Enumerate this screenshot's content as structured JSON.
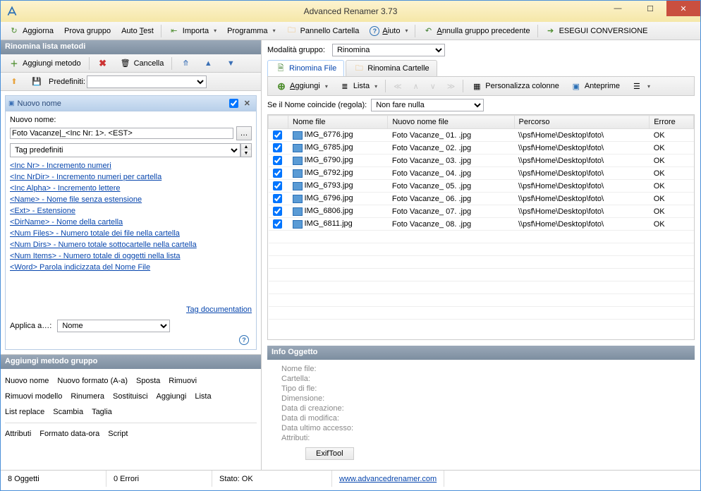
{
  "window": {
    "title": "Advanced Renamer 3.73"
  },
  "toolbar": {
    "refresh": "Aggiorna",
    "test": "Prova gruppo",
    "autotest": "Auto Test",
    "import": "Importa",
    "program": "Programma",
    "folderpanel": "Pannello Cartella",
    "help": "Aiuto",
    "undo": "Annulla gruppo precedente",
    "run": "ESEGUI CONVERSIONE"
  },
  "leftHeader": "Rinomina lista metodi",
  "leftTb": {
    "add": "Aggiungi metodo",
    "delete": "Cancella",
    "presets": "Predefiniti:"
  },
  "method": {
    "title": "Nuovo nome",
    "label": "Nuovo nome:",
    "value": "Foto Vacanze|_<Inc Nr: 1>. <EST>",
    "tagComboLabel": "Tag predefiniti",
    "tags": [
      "<Inc Nr> - Incremento numeri",
      "<Inc NrDir> - Incremento numeri per cartella",
      "<Inc Alpha> - Incremento lettere",
      "<Name> - Nome file senza estensione",
      "<Ext> - Estensione",
      "<DirName> - Nome della cartella",
      "<Num Files> - Numero totale dei file nella cartella",
      "<Num Dirs> - Numero totale sottocartelle nella cartella",
      "<Num Items> - Numero totale di oggetti nella lista",
      "<Word> Parola indicizzata del Nome File"
    ],
    "doclink": "Tag documentation",
    "applyLabel": "Applica a…:",
    "applyValue": "Nome"
  },
  "groupHeader": "Aggiungi metodo gruppo",
  "groupLinks1": [
    "Nuovo nome",
    "Nuovo formato (A-a)",
    "Sposta",
    "Rimuovi"
  ],
  "groupLinks2": [
    "Rimuovi modello",
    "Rinumera",
    "Sostituisci",
    "Aggiungi",
    "Lista"
  ],
  "groupLinks3": [
    "List replace",
    "Scambia",
    "Taglia"
  ],
  "groupLinks4": [
    "Attributi",
    "Formato data-ora",
    "Script"
  ],
  "modeLabel": "Modalità gruppo:",
  "modeValue": "Rinomina",
  "tabs": {
    "files": "Rinomina File",
    "folders": "Rinomina Cartelle"
  },
  "fileTb": {
    "add": "Aggiungi",
    "list": "Lista",
    "cols": "Personalizza colonne",
    "thumbs": "Anteprime"
  },
  "nameRule": {
    "label": "Se il Nome coincide (regola):",
    "value": "Non fare nulla"
  },
  "gridHeaders": {
    "name": "Nome file",
    "newname": "Nuovo nome file",
    "path": "Percorso",
    "error": "Errore"
  },
  "files": [
    {
      "n": "IMG_6776.jpg",
      "nn": "Foto Vacanze_ 01. .jpg",
      "p": "\\\\psf\\Home\\Desktop\\foto\\",
      "e": "OK"
    },
    {
      "n": "IMG_6785.jpg",
      "nn": "Foto Vacanze_ 02. .jpg",
      "p": "\\\\psf\\Home\\Desktop\\foto\\",
      "e": "OK"
    },
    {
      "n": "IMG_6790.jpg",
      "nn": "Foto Vacanze_ 03. .jpg",
      "p": "\\\\psf\\Home\\Desktop\\foto\\",
      "e": "OK"
    },
    {
      "n": "IMG_6792.jpg",
      "nn": "Foto Vacanze_ 04. .jpg",
      "p": "\\\\psf\\Home\\Desktop\\foto\\",
      "e": "OK"
    },
    {
      "n": "IMG_6793.jpg",
      "nn": "Foto Vacanze_ 05. .jpg",
      "p": "\\\\psf\\Home\\Desktop\\foto\\",
      "e": "OK"
    },
    {
      "n": "IMG_6796.jpg",
      "nn": "Foto Vacanze_ 06. .jpg",
      "p": "\\\\psf\\Home\\Desktop\\foto\\",
      "e": "OK"
    },
    {
      "n": "IMG_6806.jpg",
      "nn": "Foto Vacanze_ 07. .jpg",
      "p": "\\\\psf\\Home\\Desktop\\foto\\",
      "e": "OK"
    },
    {
      "n": "IMG_6811.jpg",
      "nn": "Foto Vacanze_ 08. .jpg",
      "p": "\\\\psf\\Home\\Desktop\\foto\\",
      "e": "OK"
    }
  ],
  "infoHeader": "Info Oggetto",
  "info": {
    "name": "Nome file:",
    "folder": "Cartella:",
    "type": "Tipo di fle:",
    "size": "Dimensione:",
    "created": "Data di creazione:",
    "modified": "Data di modifica:",
    "accessed": "Data ultimo accesso:",
    "attrs": "Attributi:",
    "exif": "ExifTool"
  },
  "status": {
    "objects": "8 Oggetti",
    "errors": "0 Errori",
    "state": "Stato: OK",
    "url": "www.advancedrenamer.com"
  }
}
